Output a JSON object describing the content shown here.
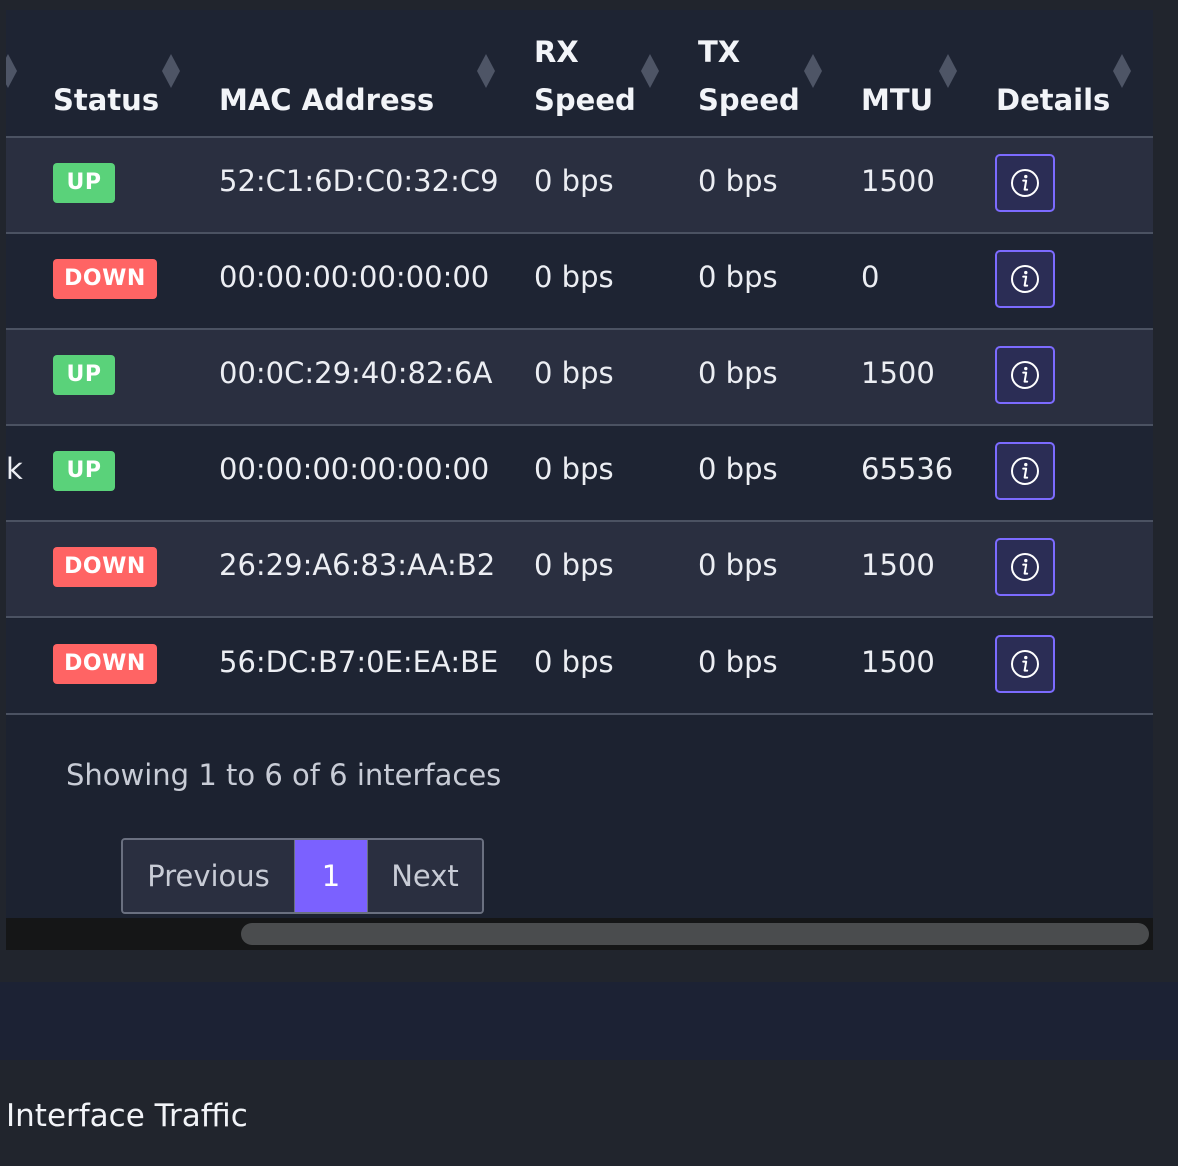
{
  "table": {
    "columns": [
      {
        "key": "status",
        "label": "Status"
      },
      {
        "key": "mac",
        "label": "MAC Address"
      },
      {
        "key": "rx",
        "label": "RX Speed"
      },
      {
        "key": "tx",
        "label": "TX Speed"
      },
      {
        "key": "mtu",
        "label": "MTU"
      },
      {
        "key": "details",
        "label": "Details"
      }
    ],
    "header_labels": {
      "status": "Status",
      "mac": "MAC Address",
      "rx_line1": "RX",
      "rx_line2": "Speed",
      "tx_line1": "TX",
      "tx_line2": "Speed",
      "mtu": "MTU",
      "details": "Details"
    },
    "rows": [
      {
        "name_fragment": "",
        "status": "UP",
        "mac": "52:C1:6D:C0:32:C9",
        "rx": "0 bps",
        "tx": "0 bps",
        "mtu": "1500"
      },
      {
        "name_fragment": "",
        "status": "DOWN",
        "mac": "00:00:00:00:00:00",
        "rx": "0 bps",
        "tx": "0 bps",
        "mtu": "0"
      },
      {
        "name_fragment": "",
        "status": "UP",
        "mac": "00:0C:29:40:82:6A",
        "rx": "0 bps",
        "tx": "0 bps",
        "mtu": "1500"
      },
      {
        "name_fragment": "k",
        "status": "UP",
        "mac": "00:00:00:00:00:00",
        "rx": "0 bps",
        "tx": "0 bps",
        "mtu": "65536"
      },
      {
        "name_fragment": "",
        "status": "DOWN",
        "mac": "26:29:A6:83:AA:B2",
        "rx": "0 bps",
        "tx": "0 bps",
        "mtu": "1500"
      },
      {
        "name_fragment": "",
        "status": "DOWN",
        "mac": "56:DC:B7:0E:EA:BE",
        "rx": "0 bps",
        "tx": "0 bps",
        "mtu": "1500"
      }
    ]
  },
  "footer": {
    "showing": "Showing 1 to 6 of 6 interfaces"
  },
  "pagination": {
    "previous": "Previous",
    "current_page": "1",
    "next": "Next"
  },
  "section": {
    "title": "Interface Traffic"
  },
  "colors": {
    "status_up": "#5ad27a",
    "status_down": "#ff6464",
    "accent": "#7b61ff",
    "info_border": "#7c6bff"
  },
  "icons": {
    "details_button": "info-circle-icon",
    "sort": "sort-diamond-icon"
  }
}
